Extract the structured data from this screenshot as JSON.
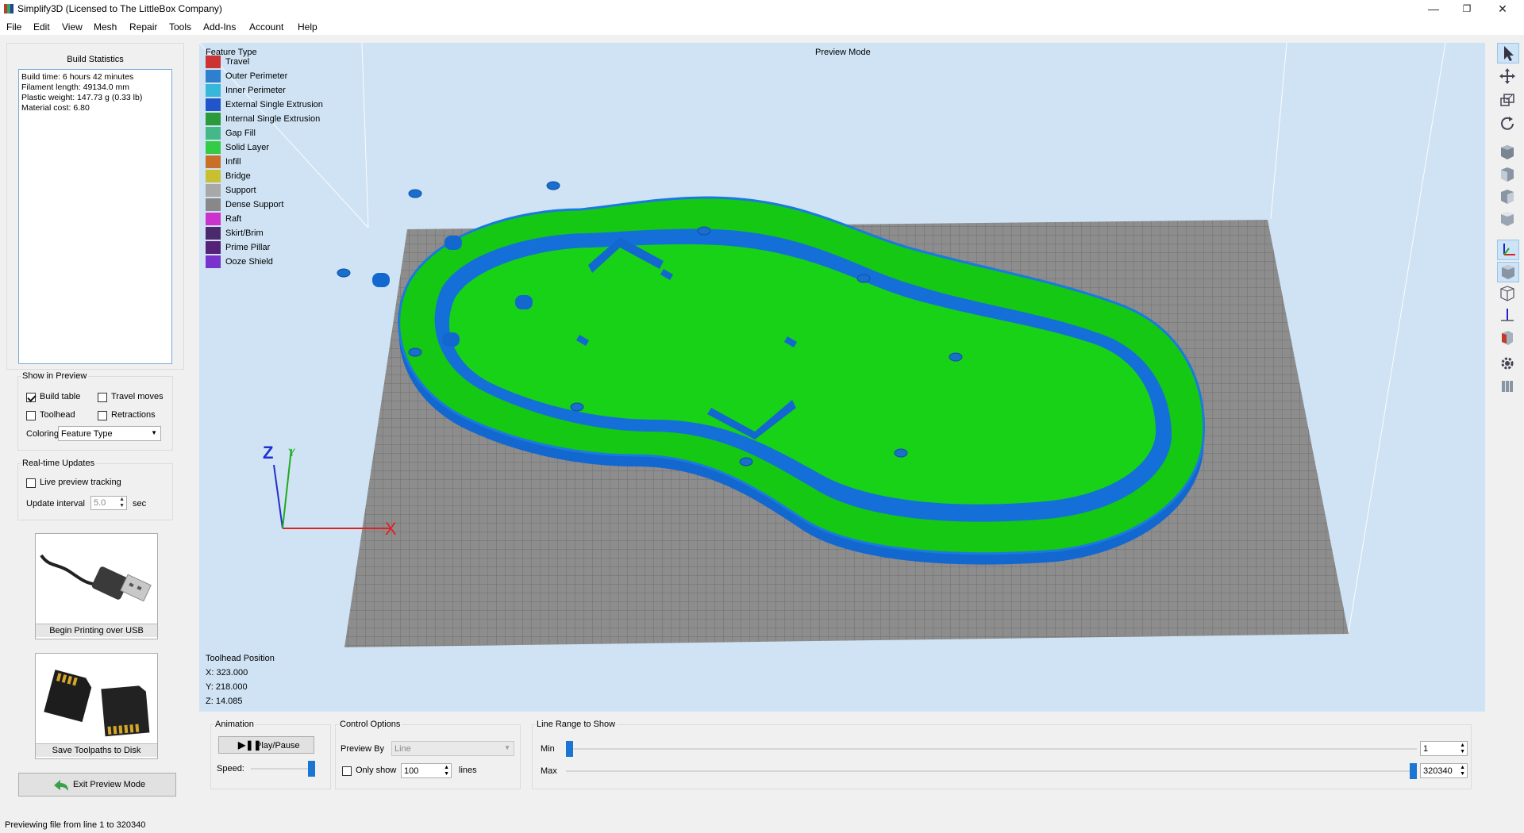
{
  "window": {
    "title": "Simplify3D (Licensed to The LittleBox Company)",
    "minimize": "—",
    "restore": "❐",
    "close": "✕"
  },
  "menu": [
    "File",
    "Edit",
    "View",
    "Mesh",
    "Repair",
    "Tools",
    "Add-Ins",
    "Account",
    "Help"
  ],
  "build_statistics": {
    "title": "Build Statistics",
    "lines": [
      "Build time: 6 hours 42 minutes",
      "Filament length: 49134.0 mm",
      "Plastic weight: 147.73 g (0.33 lb)",
      "Material cost: 6.80"
    ]
  },
  "show_in_preview": {
    "title": "Show in Preview",
    "build_table": "Build table",
    "travel_moves": "Travel moves",
    "toolhead": "Toolhead",
    "retractions": "Retractions",
    "coloring_label": "Coloring",
    "coloring_value": "Feature Type"
  },
  "realtime": {
    "title": "Real-time Updates",
    "live_tracking": "Live preview tracking",
    "interval_label": "Update interval",
    "interval_value": "5.0",
    "interval_unit": "sec"
  },
  "actions": {
    "usb_label": "Begin Printing over USB",
    "disk_label": "Save Toolpaths to Disk",
    "exit_label": "Exit Preview Mode"
  },
  "viewport": {
    "mode_label": "Preview Mode",
    "legend_title": "Feature Type",
    "legend": [
      {
        "label": "Travel",
        "color": "#cc3333"
      },
      {
        "label": "Outer Perimeter",
        "color": "#2f7fd0"
      },
      {
        "label": "Inner Perimeter",
        "color": "#38b8d8"
      },
      {
        "label": "External Single Extrusion",
        "color": "#2255cc"
      },
      {
        "label": "Internal Single Extrusion",
        "color": "#2a9a3a"
      },
      {
        "label": "Gap Fill",
        "color": "#44b888"
      },
      {
        "label": "Solid Layer",
        "color": "#33cc44"
      },
      {
        "label": "Infill",
        "color": "#c8702a"
      },
      {
        "label": "Bridge",
        "color": "#c8c030"
      },
      {
        "label": "Support",
        "color": "#a8a8a8"
      },
      {
        "label": "Dense Support",
        "color": "#888888"
      },
      {
        "label": "Raft",
        "color": "#cc33cc"
      },
      {
        "label": "Skirt/Brim",
        "color": "#4a2a6a"
      },
      {
        "label": "Prime Pillar",
        "color": "#552277"
      },
      {
        "label": "Ooze Shield",
        "color": "#7733cc"
      }
    ],
    "axis_z": "Z",
    "axis_y": "Y",
    "axis_x": "X",
    "toolhead_title": "Toolhead Position",
    "toolhead_x": "X: 323.000",
    "toolhead_y": "Y: 218.000",
    "toolhead_z": "Z: 14.085",
    "colors": {
      "bed": "#8a8a8a",
      "part_top": "#14c814",
      "part_side": "#1570d8",
      "sky": "#cfe3f4"
    }
  },
  "animation": {
    "title": "Animation",
    "play_label": "Play/Pause",
    "speed_label": "Speed:"
  },
  "control_options": {
    "title": "Control Options",
    "preview_by_label": "Preview By",
    "preview_by_value": "Line",
    "only_show_label": "Only show",
    "only_show_value": "100",
    "only_show_unit": "lines"
  },
  "line_range": {
    "title": "Line Range to Show",
    "min_label": "Min",
    "max_label": "Max",
    "min_value": "1",
    "max_value": "320340",
    "min_fraction": 0.0,
    "max_fraction": 1.0
  },
  "status": "Previewing file from line 1 to 320340"
}
